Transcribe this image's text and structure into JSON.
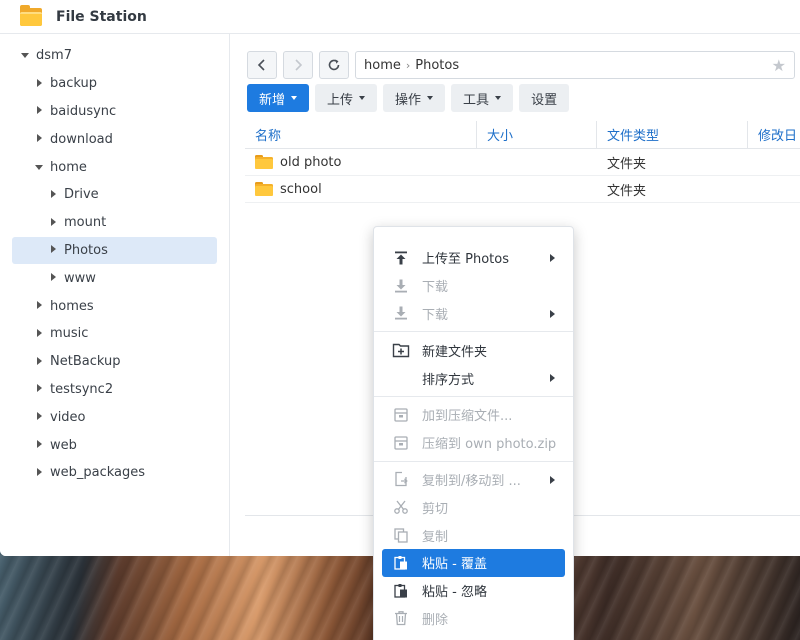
{
  "app": {
    "title": "File Station"
  },
  "sidebar": {
    "items": [
      {
        "label": "dsm7",
        "level": 0,
        "state": "expanded"
      },
      {
        "label": "backup",
        "level": 1,
        "state": "collapsed"
      },
      {
        "label": "baidusync",
        "level": 1,
        "state": "collapsed"
      },
      {
        "label": "download",
        "level": 1,
        "state": "collapsed"
      },
      {
        "label": "home",
        "level": 1,
        "state": "expanded"
      },
      {
        "label": "Drive",
        "level": 2,
        "state": "collapsed"
      },
      {
        "label": "mount",
        "level": 2,
        "state": "collapsed"
      },
      {
        "label": "Photos",
        "level": 2,
        "state": "collapsed",
        "selected": true
      },
      {
        "label": "www",
        "level": 2,
        "state": "collapsed"
      },
      {
        "label": "homes",
        "level": 1,
        "state": "collapsed"
      },
      {
        "label": "music",
        "level": 1,
        "state": "collapsed"
      },
      {
        "label": "NetBackup",
        "level": 1,
        "state": "collapsed"
      },
      {
        "label": "testsync2",
        "level": 1,
        "state": "collapsed"
      },
      {
        "label": "video",
        "level": 1,
        "state": "collapsed"
      },
      {
        "label": "web",
        "level": 1,
        "state": "collapsed"
      },
      {
        "label": "web_packages",
        "level": 1,
        "state": "collapsed"
      }
    ]
  },
  "path": {
    "segments": [
      "home",
      "Photos"
    ]
  },
  "toolbar": {
    "new_label": "新增",
    "upload_label": "上传",
    "action_label": "操作",
    "tools_label": "工具",
    "settings_label": "设置"
  },
  "table": {
    "columns": [
      "名称",
      "大小",
      "文件类型",
      "修改日"
    ],
    "rows": [
      {
        "name": "old photo",
        "size": "",
        "type": "文件夹"
      },
      {
        "name": "school",
        "size": "",
        "type": "文件夹"
      }
    ]
  },
  "context_menu": {
    "groups": [
      [
        {
          "label": "上传至 Photos",
          "icon": "upload-icon",
          "submenu": true,
          "disabled": false
        },
        {
          "label": "下载",
          "icon": "download-icon",
          "submenu": false,
          "disabled": true
        },
        {
          "label": "下载",
          "icon": "download-icon",
          "submenu": true,
          "disabled": true
        }
      ],
      [
        {
          "label": "新建文件夹",
          "icon": "new-folder-icon",
          "submenu": false,
          "disabled": false
        },
        {
          "label": "排序方式",
          "icon": "",
          "submenu": true,
          "disabled": false
        }
      ],
      [
        {
          "label": "加到压缩文件...",
          "icon": "archive-icon",
          "submenu": false,
          "disabled": true
        },
        {
          "label": "压缩到 own photo.zip",
          "icon": "archive-icon",
          "submenu": false,
          "disabled": true
        }
      ],
      [
        {
          "label": "复制到/移动到 ...",
          "icon": "copy-move-icon",
          "submenu": true,
          "disabled": true
        },
        {
          "label": "剪切",
          "icon": "scissors-icon",
          "submenu": false,
          "disabled": true
        },
        {
          "label": "复制",
          "icon": "copy-icon",
          "submenu": false,
          "disabled": true
        },
        {
          "label": "粘贴 - 覆盖",
          "icon": "paste-icon",
          "submenu": false,
          "disabled": false,
          "highlighted": true
        },
        {
          "label": "粘贴 - 忽略",
          "icon": "paste-icon",
          "submenu": false,
          "disabled": false
        },
        {
          "label": "删除",
          "icon": "trash-icon",
          "submenu": false,
          "disabled": true
        }
      ]
    ]
  },
  "colors": {
    "accent": "#1e7be0",
    "folder": "#ffc83d",
    "selected_bg": "#dde9f8"
  }
}
